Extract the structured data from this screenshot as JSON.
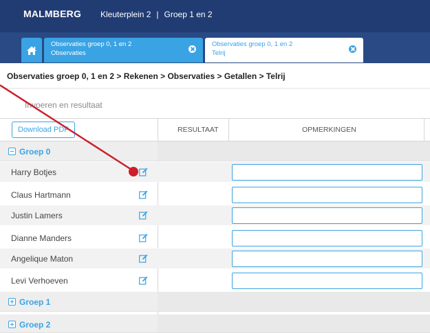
{
  "header": {
    "brand": "MALMBERG",
    "context": "Kleuterplein 2",
    "separator": "|",
    "group": "Groep 1 en 2"
  },
  "tabs": [
    {
      "line1": "Observaties groep 0, 1 en 2",
      "line2": "Observaties",
      "active": false
    },
    {
      "line1": "Observaties groep 0, 1 en 2",
      "line2": "Telrij",
      "active": true
    }
  ],
  "breadcrumb": "Observaties groep 0, 1 en 2 > Rekenen > Observaties > Getallen > Telrij",
  "subheading": "Invoeren en resultaat",
  "table": {
    "download_label": "Download PDF",
    "columns": [
      "RESULTAAT",
      "OPMERKINGEN"
    ],
    "groups": [
      {
        "label": "Groep 0",
        "expanded": true,
        "students": [
          {
            "name": "Harry Botjes",
            "result": "",
            "remark": ""
          },
          {
            "name": "Claus Hartmann",
            "result": "",
            "remark": ""
          },
          {
            "name": "Justin Lamers",
            "result": "",
            "remark": ""
          },
          {
            "name": "Dianne Manders",
            "result": "",
            "remark": ""
          },
          {
            "name": "Angelique Maton",
            "result": "",
            "remark": ""
          },
          {
            "name": "Levi Verhoeven",
            "result": "",
            "remark": ""
          }
        ]
      },
      {
        "label": "Groep 1",
        "expanded": false,
        "students": []
      },
      {
        "label": "Groep 2",
        "expanded": false,
        "students": []
      }
    ]
  },
  "icons": {
    "home": "home-icon",
    "close": "close-icon",
    "edit": "edit-icon",
    "collapse": "minus-square-icon",
    "expand": "plus-square-icon"
  },
  "colors": {
    "header_bg": "#213c73",
    "tabstrip_bg": "#294a84",
    "accent": "#3aa3e3",
    "marker": "#cc1e2c"
  }
}
